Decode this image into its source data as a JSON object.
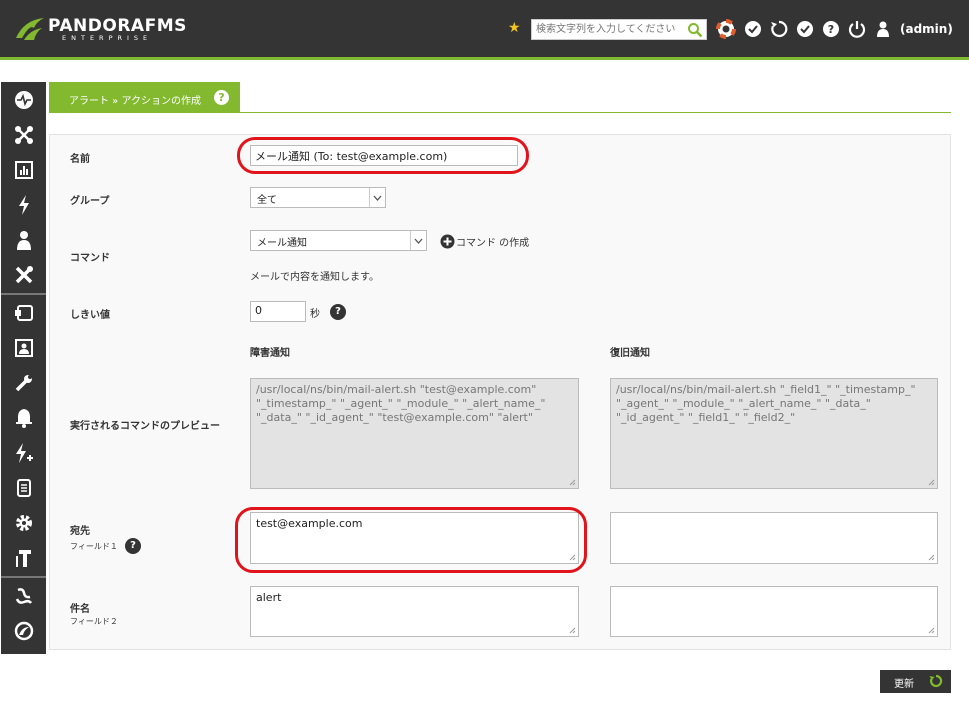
{
  "header": {
    "logo_text": "PANDORAFMS",
    "logo_sub": "ENTERPRISE",
    "search_placeholder": "検索文字列を入力してください",
    "user": "(admin)",
    "colors": {
      "bar": "#343434",
      "accent": "#82b92e"
    },
    "icons": [
      "star-icon",
      "search-icon",
      "lifebuoy-icon",
      "check-icon",
      "refresh-icon",
      "check-icon",
      "help-icon",
      "power-icon",
      "user-icon"
    ]
  },
  "sidebar": {
    "icons": [
      "monitoring-icon",
      "topology-icon",
      "reports-icon",
      "events-icon",
      "user-icon",
      "tools-icon",
      "resources-icon",
      "profile-icon",
      "configuration-icon",
      "alerts-icon",
      "servers-icon",
      "logs-icon",
      "setup-icon",
      "admin-tools-icon",
      "links-icon",
      "update-manager-icon"
    ]
  },
  "breadcrumb": {
    "text": "アラート » アクションの作成",
    "help": "?"
  },
  "form": {
    "name_label": "名前",
    "name_value": "メール通知 (To: test@example.com)",
    "group_label": "グループ",
    "group_value": "全て",
    "command_label": "コマンド",
    "command_value": "メール通知",
    "create_command": "コマンド の作成",
    "command_desc": "メールで内容を通知します。",
    "threshold_label": "しきい値",
    "threshold_value": "0",
    "threshold_unit": "秒",
    "fire_header": "障害通知",
    "recovery_header": "復旧通知",
    "preview_label": "実行されるコマンドのプレビュー",
    "preview_fire": "/usr/local/ns/bin/mail-alert.sh \"test@example.com\" \"_timestamp_\" \"_agent_\" \"_module_\" \"_alert_name_\" \"_data_\" \"_id_agent_\" \"test@example.com\" \"alert\"",
    "preview_recovery": "/usr/local/ns/bin/mail-alert.sh \"_field1_\" \"_timestamp_\" \"_agent_\" \"_module_\" \"_alert_name_\" \"_data_\" \"_id_agent_\" \"_field1_\" \"_field2_\"",
    "field1_label": "宛先",
    "field1_sub": "フィールド１",
    "field1_value": "test@example.com",
    "field1_recovery": "",
    "field2_label": "件名",
    "field2_sub": "フィールド２",
    "field2_value": "alert",
    "field2_recovery": ""
  },
  "update_button": "更新"
}
